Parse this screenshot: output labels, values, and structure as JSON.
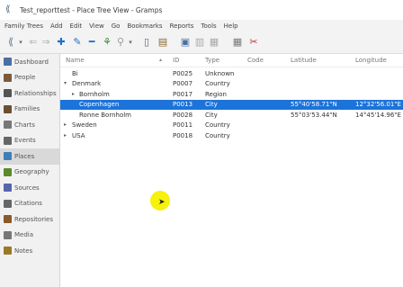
{
  "window": {
    "title": "Test_reporttest - Place Tree View - Gramps"
  },
  "menu": [
    "Family Trees",
    "Add",
    "Edit",
    "View",
    "Go",
    "Bookmarks",
    "Reports",
    "Tools",
    "Help"
  ],
  "sidebar": {
    "items": [
      {
        "label": "Dashboard",
        "icon": "dashboard-icon",
        "color": "#4a6fa5"
      },
      {
        "label": "People",
        "icon": "people-icon",
        "color": "#7b5a3a"
      },
      {
        "label": "Relationships",
        "icon": "relationships-icon",
        "color": "#555555"
      },
      {
        "label": "Families",
        "icon": "families-icon",
        "color": "#6b4f2f"
      },
      {
        "label": "Charts",
        "icon": "charts-icon",
        "color": "#777777"
      },
      {
        "label": "Events",
        "icon": "events-icon",
        "color": "#666666"
      },
      {
        "label": "Places",
        "icon": "places-icon",
        "color": "#3f7fb5"
      },
      {
        "label": "Geography",
        "icon": "geography-icon",
        "color": "#5a8a2a"
      },
      {
        "label": "Sources",
        "icon": "sources-icon",
        "color": "#5566aa"
      },
      {
        "label": "Citations",
        "icon": "citations-icon",
        "color": "#666666"
      },
      {
        "label": "Repositories",
        "icon": "repositories-icon",
        "color": "#8a5a2a"
      },
      {
        "label": "Media",
        "icon": "media-icon",
        "color": "#777777"
      },
      {
        "label": "Notes",
        "icon": "notes-icon",
        "color": "#9a7a2a"
      }
    ],
    "active_index": 6
  },
  "table": {
    "columns": [
      "Name",
      "ID",
      "Type",
      "Code",
      "Latitude",
      "Longitude"
    ],
    "rows": [
      {
        "name": "Bi",
        "id": "P0025",
        "type": "Unknown",
        "code": "",
        "lat": "",
        "lon": "",
        "expander": ""
      },
      {
        "name": "Denmark",
        "id": "P0007",
        "type": "Country",
        "code": "",
        "lat": "",
        "lon": "",
        "expander": "▾"
      },
      {
        "name": "Bornholm",
        "id": "P0017",
        "type": "Region",
        "code": "",
        "lat": "",
        "lon": "",
        "expander": "▸"
      },
      {
        "name": "Copenhagen",
        "id": "P0013",
        "type": "City",
        "code": "",
        "lat": "55°40'58.71\"N",
        "lon": "12°32'56.01\"E",
        "expander": ""
      },
      {
        "name": "Ronne Bornholm",
        "id": "P0028",
        "type": "City",
        "code": "",
        "lat": "55°03'53.44\"N",
        "lon": "14°45'14.96\"E",
        "expander": ""
      },
      {
        "name": "Sweden",
        "id": "P0011",
        "type": "Country",
        "code": "",
        "lat": "",
        "lon": "",
        "expander": "▸"
      },
      {
        "name": "USA",
        "id": "P0018",
        "type": "Country",
        "code": "",
        "lat": "",
        "lon": "",
        "expander": "▸"
      }
    ],
    "selected_index": 3
  },
  "colors": {
    "selection": "#1c73d9",
    "cursor_highlight": "#f5f000"
  }
}
